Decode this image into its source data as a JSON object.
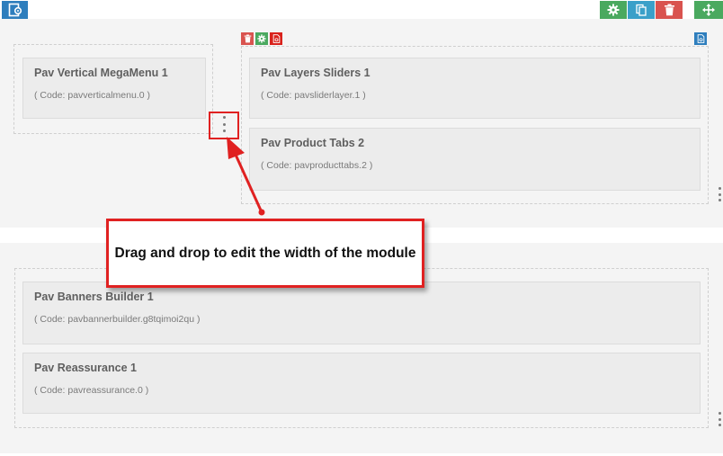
{
  "toolbar": {
    "left_icon": "layout-settings-icon",
    "right_icons": [
      "gear-icon",
      "copy-icon",
      "trash-icon",
      "move-icon"
    ],
    "colors": {
      "blue": "#2e7ebd",
      "green": "#4aa95f",
      "teal": "#3aa0c9",
      "red": "#d9534f"
    }
  },
  "rows": [
    {
      "columns": [
        {
          "modules": [
            {
              "title": "Pav Vertical MegaMenu 1",
              "code": "( Code: pavverticalmenu.0 )"
            }
          ]
        },
        {
          "modules": [
            {
              "title": "Pav Layers Sliders 1",
              "code": "( Code: pavsliderlayer.1 )"
            },
            {
              "title": "Pav Product Tabs 2",
              "code": "( Code: pavproducttabs.2 )"
            }
          ]
        }
      ]
    },
    {
      "columns": [
        {
          "modules": [
            {
              "title": "Pav Banners Builder 1",
              "code": "( Code: pavbannerbuilder.g8tqimoi2qu )"
            },
            {
              "title": "Pav Reassurance 1",
              "code": "( Code: pavreassurance.0 )"
            }
          ]
        }
      ]
    }
  ],
  "callout": {
    "text": "Drag and drop to edit the width of the module",
    "border_color": "#e02121"
  }
}
